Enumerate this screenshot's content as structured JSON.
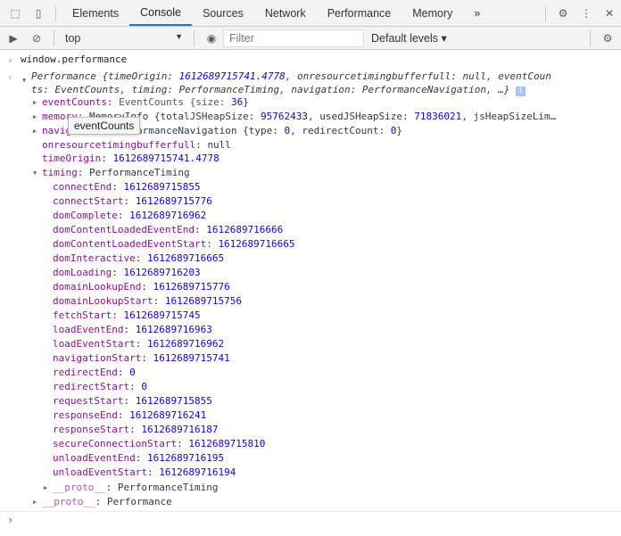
{
  "tabs": [
    "Elements",
    "Console",
    "Sources",
    "Network",
    "Performance",
    "Memory"
  ],
  "active_tab": "Console",
  "more_tabs": "»",
  "toolbar": {
    "context": "top",
    "filter_placeholder": "Filter",
    "levels": "Default levels ▾"
  },
  "input": "window.performance",
  "summary": {
    "line1_a": "Performance {timeOrigin: ",
    "time_origin": "1612689715741.4778",
    "line1_b": ", onresourcetimingbufferfull: null, eventCoun",
    "line2": "ts: EventCounts, timing: PerformanceTiming, navigation: PerformanceNavigation, …}",
    "info": "i"
  },
  "props": {
    "eventCounts": {
      "key": "eventCounts",
      "type": "EventCounts {size: ",
      "size": "36",
      "end": "}"
    },
    "memory": {
      "key": "memory",
      "type": ": MemoryInfo {totalJSHeapSize: ",
      "total": "95762433",
      "mid": ", usedJSHeapSize: ",
      "used": "71836021",
      "end": ", jsHeapSizeLim…"
    },
    "navigation": {
      "key": "navigation",
      "type": ": PerformanceNavigation {type: ",
      "t": "0",
      "mid": ", redirectCount: ",
      "rc": "0",
      "end": "}"
    },
    "onres": {
      "key": "onresourcetimingbufferfull",
      "val": "null"
    },
    "timeOrigin": {
      "key": "timeOrigin",
      "val": "1612689715741.4778"
    },
    "timing": {
      "key": "timing",
      "val": "PerformanceTiming"
    }
  },
  "timing": [
    [
      "connectEnd",
      "1612689715855"
    ],
    [
      "connectStart",
      "1612689715776"
    ],
    [
      "domComplete",
      "1612689716962"
    ],
    [
      "domContentLoadedEventEnd",
      "1612689716666"
    ],
    [
      "domContentLoadedEventStart",
      "1612689716665"
    ],
    [
      "domInteractive",
      "1612689716665"
    ],
    [
      "domLoading",
      "1612689716203"
    ],
    [
      "domainLookupEnd",
      "1612689715776"
    ],
    [
      "domainLookupStart",
      "1612689715756"
    ],
    [
      "fetchStart",
      "1612689715745"
    ],
    [
      "loadEventEnd",
      "1612689716963"
    ],
    [
      "loadEventStart",
      "1612689716962"
    ],
    [
      "navigationStart",
      "1612689715741"
    ],
    [
      "redirectEnd",
      "0"
    ],
    [
      "redirectStart",
      "0"
    ],
    [
      "requestStart",
      "1612689715855"
    ],
    [
      "responseEnd",
      "1612689716241"
    ],
    [
      "responseStart",
      "1612689716187"
    ],
    [
      "secureConnectionStart",
      "1612689715810"
    ],
    [
      "unloadEventEnd",
      "1612689716195"
    ],
    [
      "unloadEventStart",
      "1612689716194"
    ]
  ],
  "proto_timing": {
    "key": "__proto__",
    "val": "PerformanceTiming"
  },
  "proto": {
    "key": "__proto__",
    "val": "Performance"
  },
  "tooltip": "eventCounts",
  "colors": {
    "accent": "#1a73e8",
    "key": "#881391",
    "number": "#1c00cf"
  }
}
